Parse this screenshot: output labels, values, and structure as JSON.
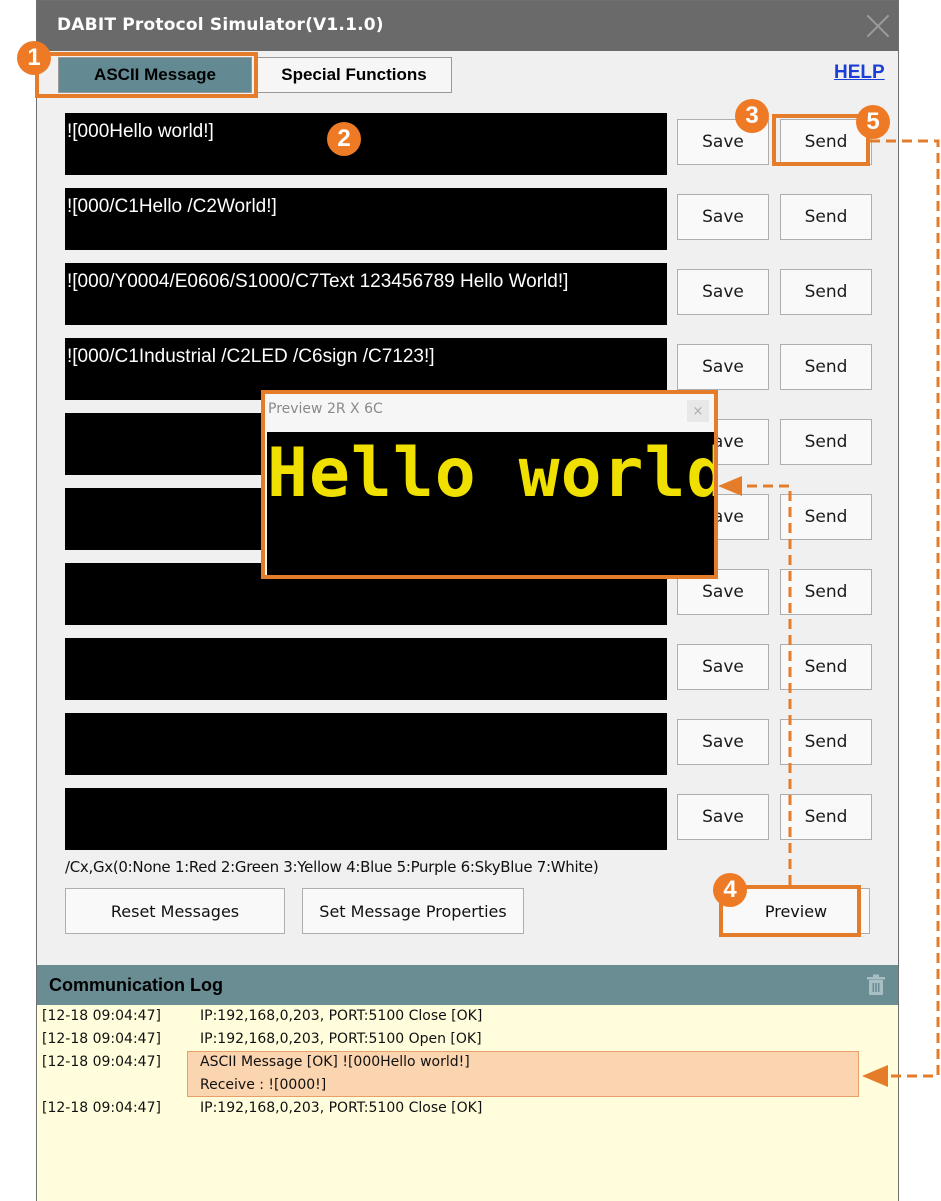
{
  "window": {
    "title": "DABIT Protocol Simulator(V1.1.0)"
  },
  "tabs": [
    {
      "label": "ASCII Message",
      "active": true
    },
    {
      "label": "Special Functions",
      "active": false
    }
  ],
  "help_label": "HELP",
  "messages": [
    "![000Hello world!]",
    "![000/C1Hello /C2World!]",
    "![000/Y0004/E0606/S1000/C7Text 123456789 Hello World!]",
    "![000/C1Industrial  /C2LED /C6sign /C7123!]",
    "",
    "",
    "",
    "",
    "",
    ""
  ],
  "row_buttons": {
    "save_label": "Save",
    "send_label": "Send"
  },
  "color_hint": "/Cx,Gx(0:None 1:Red 2:Green 3:Yellow 4:Blue 5:Purple 6:SkyBlue 7:White)",
  "bottom_buttons": {
    "reset": "Reset Messages",
    "properties": "Set Message Properties",
    "preview": "Preview"
  },
  "log": {
    "title": "Communication Log",
    "entries": [
      {
        "time": "[12-18 09:04:47]",
        "lines": [
          "IP:192,168,0,203, PORT:5100 Close [OK]"
        ]
      },
      {
        "time": "[12-18 09:04:47]",
        "lines": [
          "IP:192,168,0,203, PORT:5100 Open [OK]"
        ]
      },
      {
        "time": "[12-18 09:04:47]",
        "lines": [
          "ASCII Message [OK] ![000Hello world!]",
          "Receive : ![0000!]"
        ]
      },
      {
        "time": "[12-18 09:04:47]",
        "lines": [
          "IP:192,168,0,203, PORT:5100 Close [OK]"
        ]
      }
    ]
  },
  "preview_window": {
    "title": "Preview 2R X 6C",
    "close_glyph": "×",
    "display_text": "Hello world",
    "display_color": "#f0e000"
  },
  "annotations": {
    "badges": [
      "1",
      "2",
      "3",
      "4",
      "5"
    ],
    "highlight_color": "#e57c2a"
  }
}
